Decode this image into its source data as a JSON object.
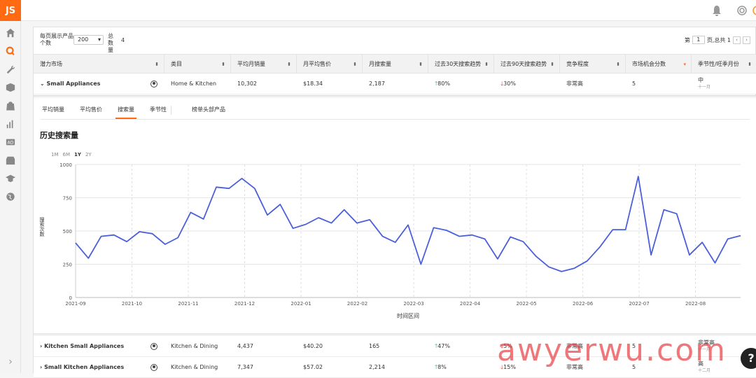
{
  "app": {
    "logo": "JS"
  },
  "sidebar": {
    "icons": [
      "home-icon",
      "search-icon",
      "wrench-icon",
      "box-icon",
      "bag-icon",
      "bar-chart-icon",
      "ad-icon",
      "store-icon",
      "graduation-icon",
      "globe-icon"
    ],
    "collapse": "›"
  },
  "topbar": {
    "icons": [
      "bell-icon",
      "settings-icon",
      "sun-icon"
    ]
  },
  "controls": {
    "per_page_label": "每页展示产品个数",
    "per_page_value": "200",
    "total_label": "总数量",
    "total_value": "4",
    "page_prefix": "第",
    "page_value": "1",
    "page_suffix": "页,总共 1"
  },
  "table": {
    "headers": [
      "潜力市场",
      "类目",
      "平均月销量",
      "月平均售价",
      "月搜索量",
      "过去30天搜索趋势",
      "过去90天搜索趋势",
      "竞争程度",
      "市场机会分数",
      "季节性/旺季月份"
    ],
    "rows": [
      {
        "market": "Small Appliances",
        "category": "Home & Kitchen",
        "sales": "10,302",
        "price": "$18.34",
        "search": "2,187",
        "t30": "80%",
        "t90": "30%",
        "competition": "非常高",
        "score": "5",
        "season": "中",
        "peak": "十一月"
      },
      {
        "market": "Kitchen Small Appliances",
        "category": "Kitchen & Dining",
        "sales": "4,437",
        "price": "$40.20",
        "search": "165",
        "t30": "47%",
        "t90": "5%",
        "competition": "非常高",
        "score": "5",
        "season": "非常高",
        "peak": "十一月"
      },
      {
        "market": "Small Kitchen Appliances",
        "category": "Kitchen & Dining",
        "sales": "7,347",
        "price": "$57.02",
        "search": "2,214",
        "t30": "8%",
        "t90": "15%",
        "competition": "非常高",
        "score": "5",
        "season": "高",
        "peak": "十二月"
      }
    ]
  },
  "detail": {
    "tabs": [
      "平均销量",
      "平均售价",
      "搜索量",
      "季节性",
      "榜单头部产品"
    ],
    "active_tab": "搜索量",
    "title": "历史搜索量",
    "ranges": [
      "1M",
      "6M",
      "1Y",
      "2Y"
    ],
    "active_range": "1Y"
  },
  "chart_data": {
    "type": "line",
    "title": "历史搜索量",
    "xlabel": "时间区间",
    "ylabel": "搜索次数",
    "ylim": [
      0,
      1000
    ],
    "yticks": [
      0,
      250,
      500,
      750,
      1000
    ],
    "xticks": [
      "2021-09",
      "2021-10",
      "2021-11",
      "2021-12",
      "2022-01",
      "2022-02",
      "2022-03",
      "2022-04",
      "2022-05",
      "2022-06",
      "2022-07",
      "2022-08"
    ],
    "grid": true,
    "series_color": "#4a5fdc",
    "series": [
      {
        "values": [
          410,
          295,
          460,
          470,
          420,
          495,
          480,
          400,
          450,
          640,
          590,
          830,
          820,
          895,
          820,
          620,
          700,
          520,
          550,
          600,
          560,
          660,
          560,
          585,
          460,
          415,
          545,
          250,
          525,
          505,
          460,
          470,
          440,
          290,
          455,
          420,
          310,
          230,
          195,
          220,
          275,
          380,
          510,
          510,
          910,
          320,
          660,
          630,
          320,
          415,
          260,
          440,
          465
        ]
      }
    ]
  },
  "watermark": "awyerwu.com",
  "help": "?"
}
